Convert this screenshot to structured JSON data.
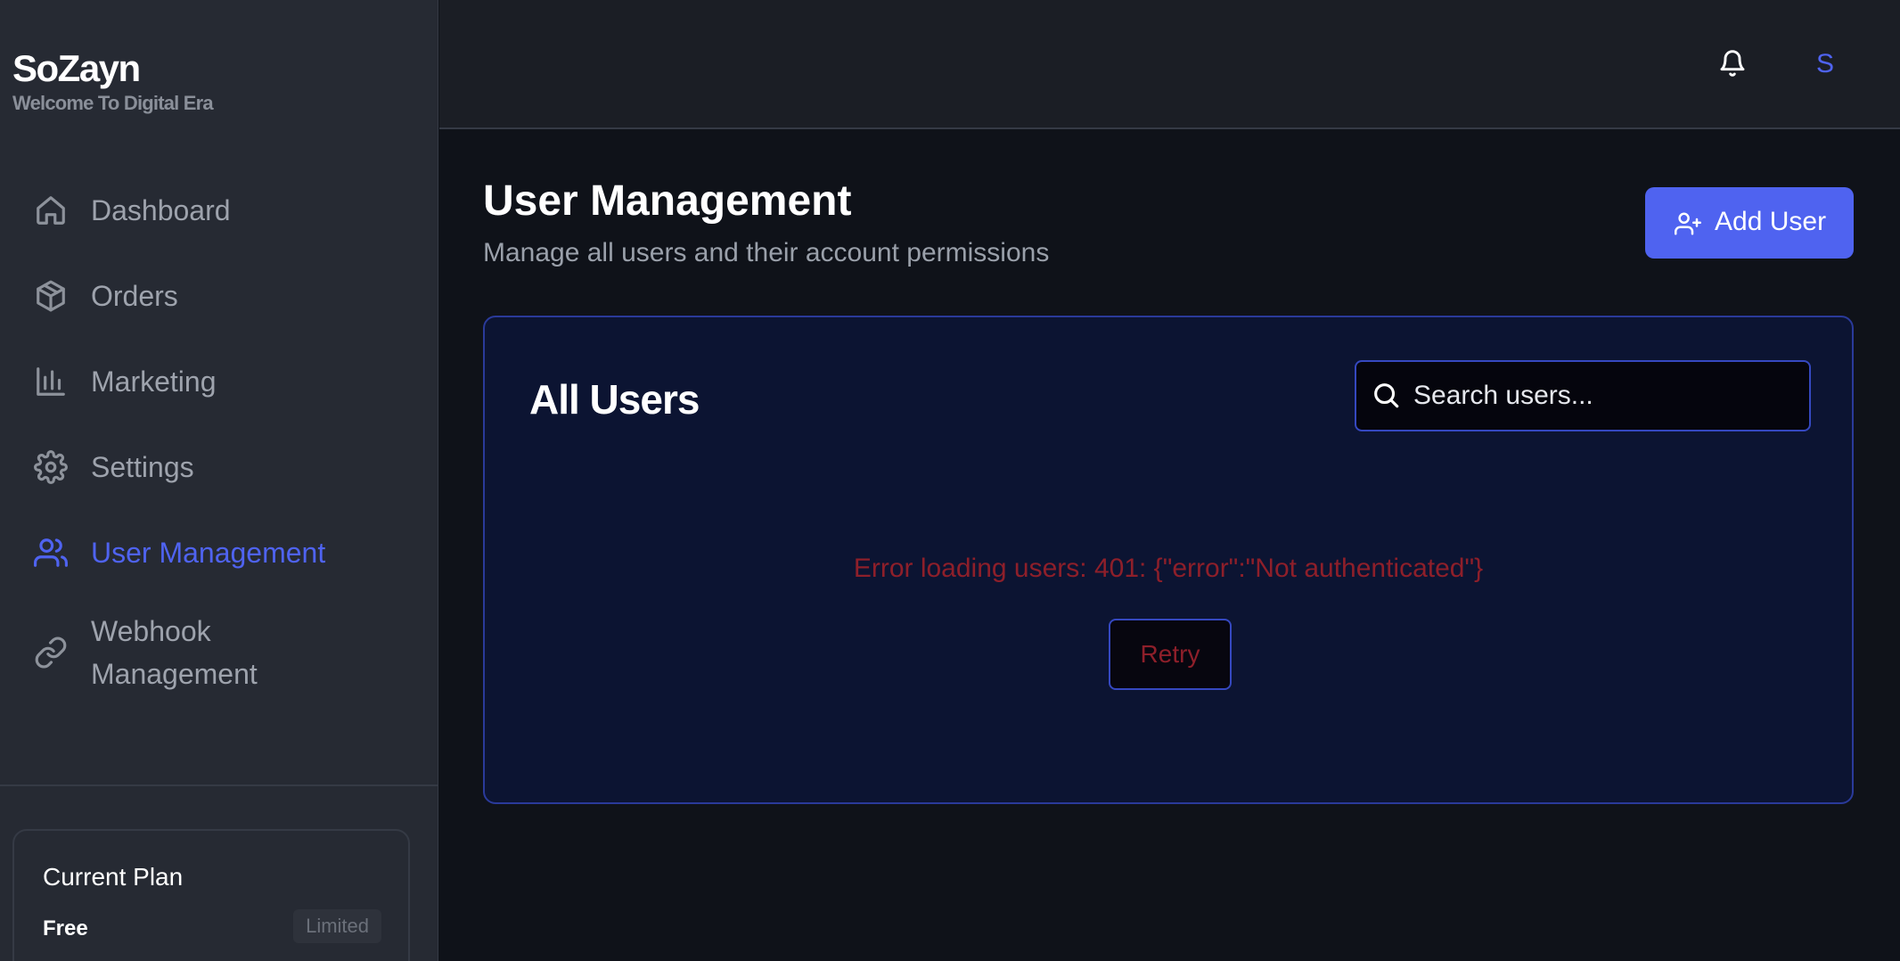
{
  "brand": {
    "name": "SoZayn",
    "tagline": "Welcome To Digital Era"
  },
  "sidebar": {
    "items": [
      {
        "label": "Dashboard",
        "icon": "home-icon"
      },
      {
        "label": "Orders",
        "icon": "package-icon"
      },
      {
        "label": "Marketing",
        "icon": "bar-chart-icon"
      },
      {
        "label": "Settings",
        "icon": "gear-icon"
      },
      {
        "label": "User Management",
        "icon": "users-icon",
        "active": true
      },
      {
        "label": "Webhook Management",
        "icon": "link-icon"
      }
    ],
    "plan": {
      "title": "Current Plan",
      "name": "Free",
      "badge": "Limited"
    }
  },
  "topbar": {
    "bell_icon": "bell-icon",
    "avatar_initial": "S"
  },
  "main": {
    "title": "User Management",
    "subtitle": "Manage all users and their account permissions",
    "add_user_label": "Add User",
    "card": {
      "title": "All Users",
      "search_placeholder": "Search users...",
      "error_message": "Error loading users: 401: {\"error\":\"Not authenticated\"}",
      "retry_label": "Retry"
    }
  },
  "colors": {
    "accent": "#4f63f0",
    "error": "#8e1f2a",
    "sidebar_bg": "#262a33",
    "card_bg": "#0c1432"
  }
}
